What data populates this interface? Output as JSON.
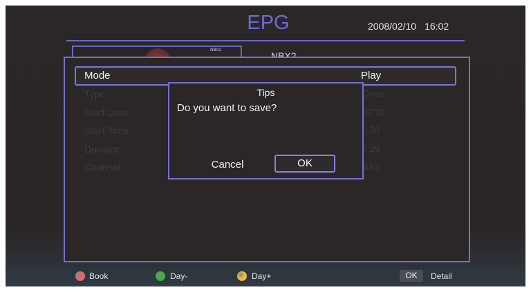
{
  "header": {
    "title": "EPG",
    "date": "2008/02/10",
    "time": "16:02"
  },
  "channel": {
    "name": "NBX2",
    "logo_tag": "NBX2"
  },
  "form": {
    "mode": {
      "label": "Mode",
      "value": "Play"
    },
    "rows": [
      {
        "label": "Type",
        "value": "Once"
      },
      {
        "label": "Start Date",
        "value": "02/10"
      },
      {
        "label": "Start Time",
        "value": "0:30"
      },
      {
        "label": "Duration",
        "value": "0:29"
      },
      {
        "label": "Channel",
        "value": "BX2"
      }
    ]
  },
  "dialog": {
    "title": "Tips",
    "message": "Do you want to save?",
    "cancel_label": "Cancel",
    "ok_label": "OK"
  },
  "footer": {
    "book": {
      "label": "Book",
      "color": "#e06a6a"
    },
    "day_minus": {
      "label": "Day-",
      "color": "#3fae3f"
    },
    "day_plus": {
      "label": "Day+",
      "color": "#f2b93a"
    },
    "ok_key": "OK",
    "detail": "Detail"
  }
}
